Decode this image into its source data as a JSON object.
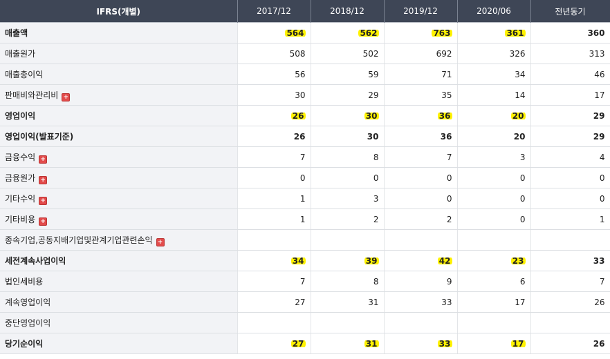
{
  "header": {
    "label": "IFRS(개별)",
    "columns": [
      "2017/12",
      "2018/12",
      "2019/12",
      "2020/06",
      "전년동기"
    ]
  },
  "rows": [
    {
      "label": "매출액",
      "bold": true,
      "expand": false,
      "values": [
        "564",
        "562",
        "763",
        "361",
        "360"
      ],
      "highlight": [
        true,
        true,
        true,
        true,
        false
      ]
    },
    {
      "label": "매출원가",
      "bold": false,
      "expand": false,
      "values": [
        "508",
        "502",
        "692",
        "326",
        "313"
      ],
      "highlight": [
        false,
        false,
        false,
        false,
        false
      ]
    },
    {
      "label": "매출총이익",
      "bold": false,
      "expand": false,
      "values": [
        "56",
        "59",
        "71",
        "34",
        "46"
      ],
      "highlight": [
        false,
        false,
        false,
        false,
        false
      ]
    },
    {
      "label": "판매비와관리비",
      "bold": false,
      "expand": true,
      "values": [
        "30",
        "29",
        "35",
        "14",
        "17"
      ],
      "highlight": [
        false,
        false,
        false,
        false,
        false
      ]
    },
    {
      "label": "영업이익",
      "bold": true,
      "expand": false,
      "values": [
        "26",
        "30",
        "36",
        "20",
        "29"
      ],
      "highlight": [
        true,
        true,
        true,
        true,
        false
      ]
    },
    {
      "label": "영업이익(발표기준)",
      "bold": true,
      "expand": false,
      "values": [
        "26",
        "30",
        "36",
        "20",
        "29"
      ],
      "highlight": [
        false,
        false,
        false,
        false,
        false
      ]
    },
    {
      "label": "금융수익",
      "bold": false,
      "expand": true,
      "values": [
        "7",
        "8",
        "7",
        "3",
        "4"
      ],
      "highlight": [
        false,
        false,
        false,
        false,
        false
      ]
    },
    {
      "label": "금융원가",
      "bold": false,
      "expand": true,
      "values": [
        "0",
        "0",
        "0",
        "0",
        "0"
      ],
      "highlight": [
        false,
        false,
        false,
        false,
        false
      ]
    },
    {
      "label": "기타수익",
      "bold": false,
      "expand": true,
      "values": [
        "1",
        "3",
        "0",
        "0",
        "0"
      ],
      "highlight": [
        false,
        false,
        false,
        false,
        false
      ]
    },
    {
      "label": "기타비용",
      "bold": false,
      "expand": true,
      "values": [
        "1",
        "2",
        "2",
        "0",
        "1"
      ],
      "highlight": [
        false,
        false,
        false,
        false,
        false
      ]
    },
    {
      "label": "종속기업,공동지배기업및관계기업관련손익",
      "bold": false,
      "expand": true,
      "values": [
        "",
        "",
        "",
        "",
        ""
      ],
      "highlight": [
        false,
        false,
        false,
        false,
        false
      ]
    },
    {
      "label": "세전계속사업이익",
      "bold": true,
      "expand": false,
      "values": [
        "34",
        "39",
        "42",
        "23",
        "33"
      ],
      "highlight": [
        true,
        true,
        true,
        true,
        false
      ]
    },
    {
      "label": "법인세비용",
      "bold": false,
      "expand": false,
      "values": [
        "7",
        "8",
        "9",
        "6",
        "7"
      ],
      "highlight": [
        false,
        false,
        false,
        false,
        false
      ]
    },
    {
      "label": "계속영업이익",
      "bold": false,
      "expand": false,
      "values": [
        "27",
        "31",
        "33",
        "17",
        "26"
      ],
      "highlight": [
        false,
        false,
        false,
        false,
        false
      ]
    },
    {
      "label": "중단영업이익",
      "bold": false,
      "expand": false,
      "values": [
        "",
        "",
        "",
        "",
        ""
      ],
      "highlight": [
        false,
        false,
        false,
        false,
        false
      ]
    },
    {
      "label": "당기순이익",
      "bold": true,
      "expand": false,
      "values": [
        "27",
        "31",
        "33",
        "17",
        "26"
      ],
      "highlight": [
        true,
        true,
        true,
        true,
        false
      ]
    }
  ],
  "colors": {
    "header_bg": "#3e4656",
    "label_bg": "#f2f3f6",
    "highlight": "#fff200",
    "expand_icon": "#e24b4b"
  },
  "icons": {
    "expand": "plus-icon"
  }
}
